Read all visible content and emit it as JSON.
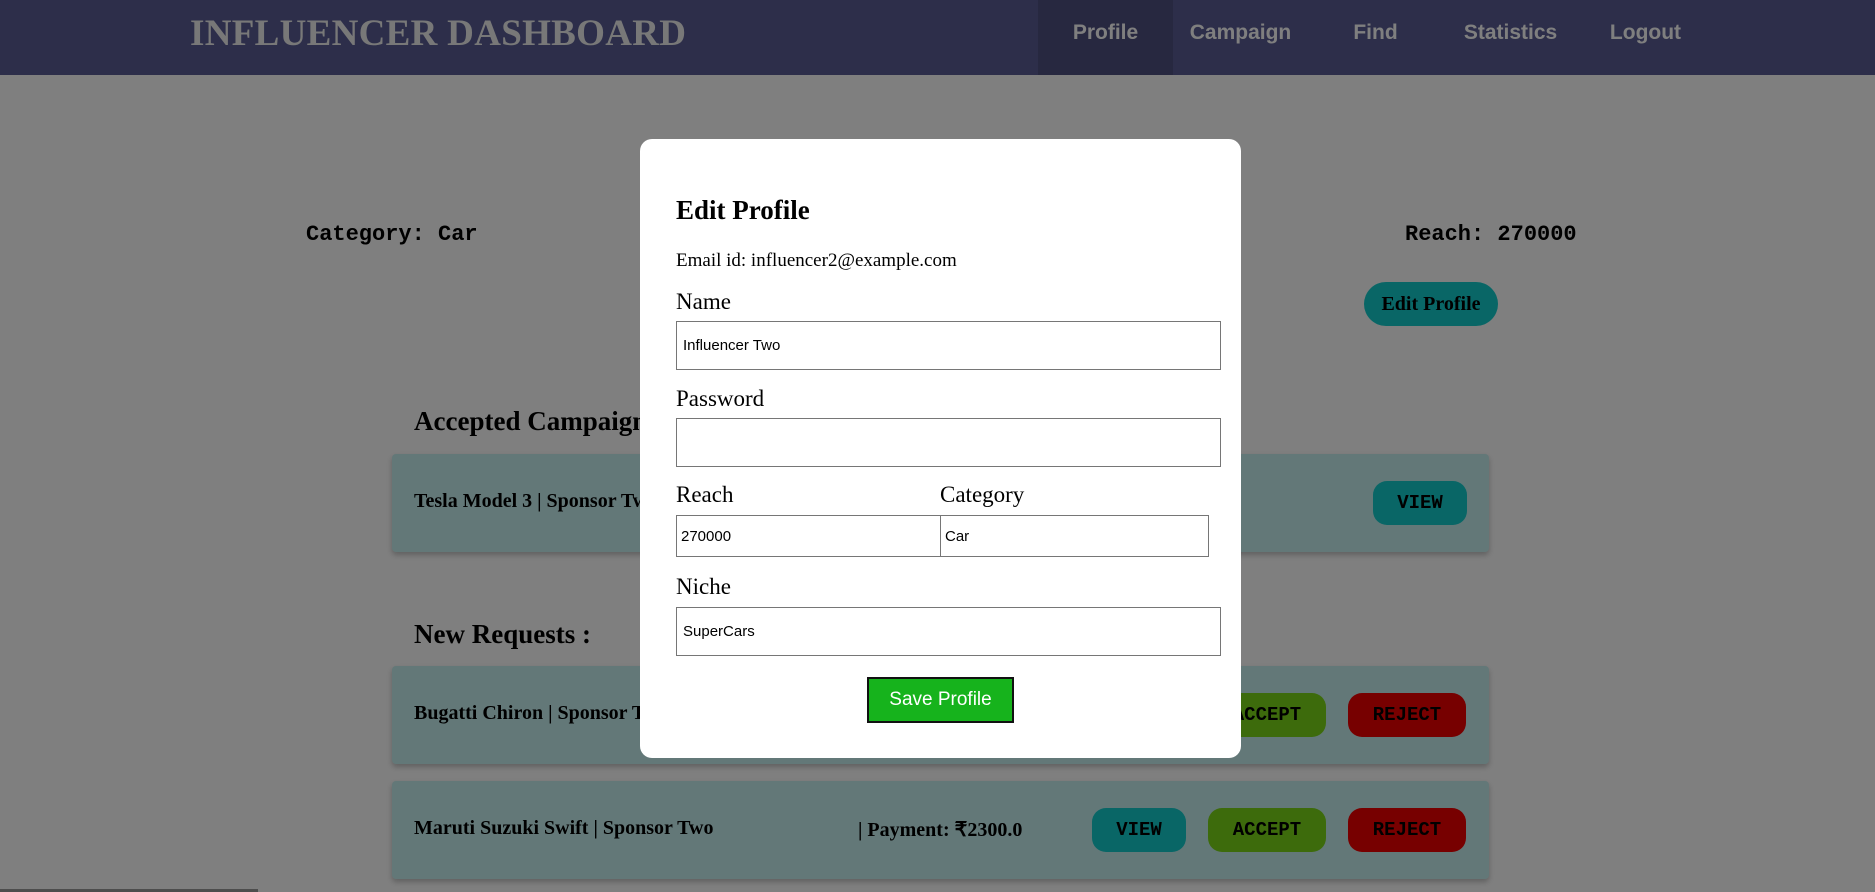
{
  "header": {
    "brand": "INFLUENCER DASHBOARD",
    "nav": [
      {
        "label": "Profile",
        "active": true
      },
      {
        "label": "Campaign"
      },
      {
        "label": "Find"
      },
      {
        "label": "Statistics"
      },
      {
        "label": "Logout"
      }
    ]
  },
  "profile": {
    "category": "Category: Car",
    "reach": "Reach: 270000",
    "edit_button": "Edit Profile"
  },
  "accepted": {
    "title": "Accepted Campaigns :",
    "items": [
      {
        "title": "Tesla Model 3 | Sponsor Two",
        "view": "VIEW"
      }
    ]
  },
  "requests": {
    "title": "New Requests :",
    "items": [
      {
        "title": "Bugatti Chiron | Sponsor Two",
        "accept": "ACCEPT",
        "reject": "REJECT"
      },
      {
        "title": "Maruti Suzuki Swift | Sponsor Two",
        "payment": "| Payment: ₹2300.0",
        "view": "VIEW",
        "accept": "ACCEPT",
        "reject": "REJECT"
      }
    ]
  },
  "modal": {
    "title": "Edit Profile",
    "email": "Email id: influencer2@example.com",
    "name_label": "Name",
    "name_value": "Influencer Two",
    "password_label": "Password",
    "password_value": "",
    "reach_label": "Reach",
    "reach_value": "270000",
    "category_label": "Category",
    "category_value": "Car",
    "niche_label": "Niche",
    "niche_value": "SuperCars",
    "save_button": "Save Profile"
  },
  "colors": {
    "navbar": "#5a5c94",
    "teal": "#12cccc",
    "green": "#7ad619",
    "red": "#ee0000",
    "save": "#16b31c",
    "card": "#c7f0f1"
  }
}
